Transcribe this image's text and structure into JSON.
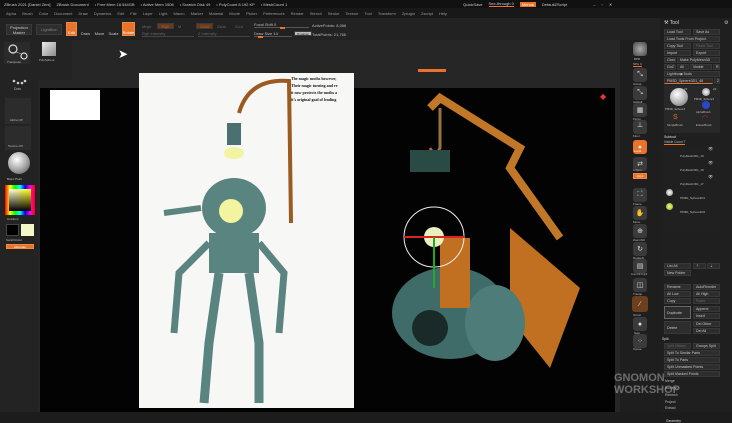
{
  "titlebar": {
    "app": "ZBrush 2021 [Daniel Zeni]",
    "doc": "ZBrush Document",
    "free_mem": "• Free Mem 18.544GB",
    "active_mem": "• Active Mem 1506",
    "scratch": "• Scratch Disk 49",
    "polycount": "• PolyCount 8.192 KP",
    "meshcount": "• MeshCount 1",
    "quicksave": "QuickSave",
    "seethrough": "See-through 0",
    "menus": "Menus",
    "script": "DefaultZScript"
  },
  "menubar": [
    "Alpha",
    "Brush",
    "Color",
    "Document",
    "Draw",
    "Dynamics",
    "Edit",
    "File",
    "Layer",
    "Light",
    "Macro",
    "Marker",
    "Material",
    "Movie",
    "Picker",
    "Preferences",
    "Render",
    "Stencil",
    "Stroke",
    "Texture",
    "Tool",
    "Transform",
    "Zplugin",
    "Zscript",
    "Help"
  ],
  "shelf": {
    "projection_master": "Projection Master",
    "lightbox": "LightBox",
    "edit": "Edit",
    "draw": "Draw",
    "move": "Move",
    "scale": "Scale",
    "rotate": "Rotate",
    "mrgb": "Mrgb",
    "rgb": "Rgb",
    "m": "M",
    "zadd": "Zadd",
    "zsub": "Zsub",
    "zcut": "Zcut",
    "rgb_intensity": "Rgb Intensity",
    "z_intensity": "Z Intensity",
    "focal_shift": "Focal Shift 0",
    "draw_size": "Draw Size 14",
    "dynamic": "Dynamic",
    "active_points": "ActivePoints: 8,066",
    "total_points": "TotalPoints: 21,766"
  },
  "left": {
    "transpose": "Transpose",
    "polysphere": "PolySphere",
    "dots": "Dots",
    "alpha": "Alpha Off",
    "texture": "Texture Off",
    "material": "Basic Paint",
    "gradient": "Gradient",
    "switch_color": "SwitchColor",
    "alternate": "Alternate"
  },
  "reference_text": [
    "The magic moths however,",
    "Their magic turning and re",
    "it now protects the moths a",
    "it's original goal of leading"
  ],
  "righticons": [
    "BPR",
    "SPix 3",
    "Actual",
    "AAHalf",
    "Persp",
    "Floor",
    "Local",
    "L.Sym",
    "Qxyz",
    "Frame",
    "Move",
    "ZoomSD",
    "RotateS",
    "Line Fill PolyF",
    "Transp",
    "Ghost",
    "Solo",
    "Xpose"
  ],
  "tray": {
    "title": "Tool",
    "load_tool": "Load Tool",
    "save_as": "Save As",
    "load_from_project": "Load Tools From Project",
    "copy_tool": "Copy Tool",
    "paste_tool": "Paste Tool",
    "import": "Import",
    "export": "Export",
    "clone": "Clone",
    "make_polymesh": "Make PolyMesh3D",
    "goz": "GoZ",
    "all": "All",
    "visible": "Visible",
    "r": "R",
    "lightbox_tools": "Lightbox▶Tools",
    "current_tool": "PM3D_Sphere3D1_48",
    "tool_count": "2",
    "thumbs": [
      "PM3D_Sphere3",
      "PM3D_Sphere3",
      "AlphaBrush",
      "SimpleBrush",
      "EraserBrush"
    ],
    "thumb_count": "23",
    "subtool": "Subtool",
    "visible_count": "Visible Count 7",
    "subtools": [
      "PolyMesh3D1_19",
      "PolyMesh3D1_18",
      "PolyMesh3D1_17",
      "PM3D_Sphere3D1",
      "PM3D_Sphere3D2"
    ],
    "list_all": "List All",
    "new_folder": "New Folder",
    "rename": "Rename",
    "autoreorder": "AutoReorder",
    "all_low": "All Low",
    "all_high": "All High",
    "copy": "Copy",
    "paste": "Paste",
    "duplicate": "Duplicate",
    "append": "Append",
    "insert": "Insert",
    "delete": "Delete",
    "del_other": "Del Other",
    "del_all": "Del All",
    "split": "Split",
    "split_hidden": "Split Hidden",
    "groups_split": "Groups Split",
    "split_similar": "Split To Similar Parts",
    "split_parts": "Split To Parts",
    "split_unmasked": "Split Unmasked Points",
    "split_masked": "Split Masked Points",
    "merge": "Merge",
    "boolean": "Boolean",
    "remesh": "Remesh",
    "project": "Project",
    "extract": "Extract",
    "geometry": "Geometry"
  },
  "watermark": "GNOMON WORKSHOP",
  "colors": {
    "accent": "#e8732a",
    "primary_color": "#000000",
    "secondary_color": "#f4f8c8"
  }
}
